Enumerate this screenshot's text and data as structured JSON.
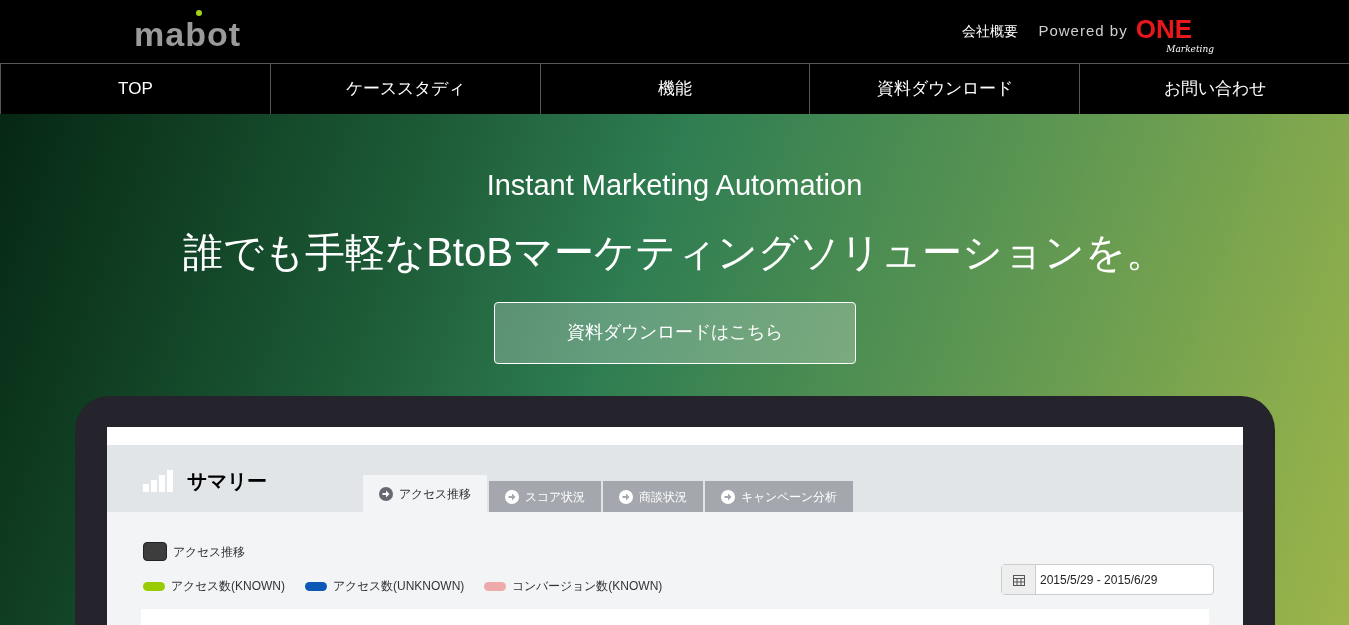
{
  "header": {
    "logo": "mabot",
    "links": [
      {
        "label": "会社概要"
      }
    ],
    "powered_by": "Powered by",
    "brand": "ONE",
    "brand_sub": "Marketing"
  },
  "nav": [
    {
      "label": "TOP"
    },
    {
      "label": "ケーススタディ"
    },
    {
      "label": "機能"
    },
    {
      "label": "資料ダウンロード"
    },
    {
      "label": "お問い合わせ"
    }
  ],
  "hero": {
    "subtitle": "Instant Marketing Automation",
    "title": "誰でも手軽なBtoBマーケティングソリューションを。",
    "cta": "資料ダウンロードはこちら"
  },
  "app": {
    "title": "サマリー",
    "tabs": [
      {
        "label": "アクセス推移",
        "selected": true
      },
      {
        "label": "スコア状況",
        "selected": false
      },
      {
        "label": "商談状況",
        "selected": false
      },
      {
        "label": "キャンペーン分析",
        "selected": false
      }
    ],
    "section_title": "アクセス推移",
    "legend": [
      {
        "label": "アクセス数(KNOWN)",
        "color": "#99cc00"
      },
      {
        "label": "アクセス数(UNKNOWN)",
        "color": "#0b58b5"
      },
      {
        "label": "コンバージョン数(KNOWN)",
        "color": "#eeaaaa"
      }
    ],
    "date_range": "2015/5/29 - 2015/6/29"
  }
}
